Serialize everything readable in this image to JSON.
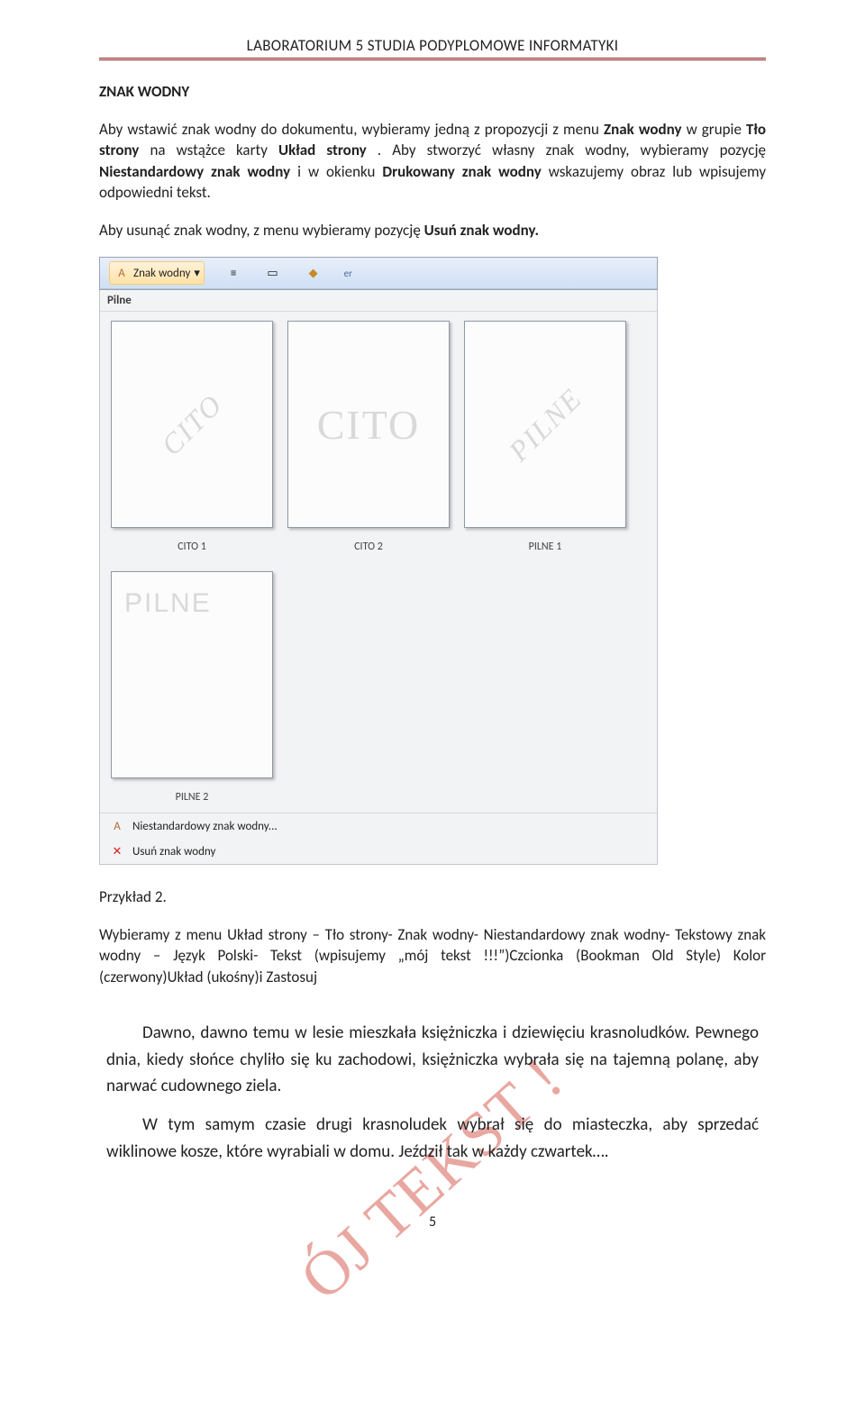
{
  "header": {
    "title": "LABORATORIUM 5 STUDIA PODYPLOMOWE INFORMATYKI"
  },
  "section1": {
    "heading": "ZNAK WODNY",
    "p1_pre": "Aby wstawić znak wodny do dokumentu, wybieramy jedną z propozycji z menu ",
    "p1_b1": "Znak wodny",
    "p1_mid": " w grupie ",
    "p1_b2": "Tło strony",
    "p1_mid2": " na wstążce karty ",
    "p1_b3": "Układ strony",
    "p1_end": ". Aby stworzyć własny znak wodny, wybieramy pozycję ",
    "p1_b4": "Niestandardowy znak wodny",
    "p1_mid3": " i w okienku ",
    "p1_b5": "Drukowany znak wodny",
    "p1_end2": " wskazujemy obraz lub wpisujemy odpowiedni tekst.",
    "p2_pre": "Aby usunąć znak wodny, z menu wybieramy pozycję ",
    "p2_b1": "Usuń znak wodny."
  },
  "ribbon": {
    "btn_label": "Znak wodny",
    "gallery_header": "Pilne",
    "thumbs": [
      {
        "wm": "CITO",
        "label": "CITO 1",
        "style": "diag"
      },
      {
        "wm": "CITO",
        "label": "CITO 2",
        "style": "horiz"
      },
      {
        "wm": "PILNE",
        "label": "PILNE 1",
        "style": "diag"
      },
      {
        "wm": "PILNE",
        "label": "PILNE 2",
        "style": "top"
      }
    ],
    "menu1": "Niestandardowy znak wodny...",
    "menu2": "Usuń znak wodny"
  },
  "section2": {
    "heading": "Przykład 2.",
    "p1": "Wybieramy z menu Układ strony – Tło strony- Znak wodny- Niestandardowy znak wodny- Tekstowy znak wodny – Język Polski- Tekst (wpisujemy „mój tekst !!!”)Czcionka (Bookman Old Style) Kolor (czerwony)Układ (ukośny)i Zastosuj",
    "ex_p1": "Dawno, dawno temu w lesie mieszkała księżniczka i dziewięciu krasnoludków. Pewnego dnia, kiedy słońce chyliło się ku zachodowi, księżniczka wybrała się na tajemną polanę, aby narwać cudownego ziela.",
    "ex_p2": "W tym samym czasie drugi krasnoludek wybrał się do miasteczka, aby sprzedać wiklinowe kosze, które wyrabiali w domu. Jeździł tak w każdy czwartek….",
    "watermark": "ÓJ TEKST !"
  },
  "page_number": "5"
}
